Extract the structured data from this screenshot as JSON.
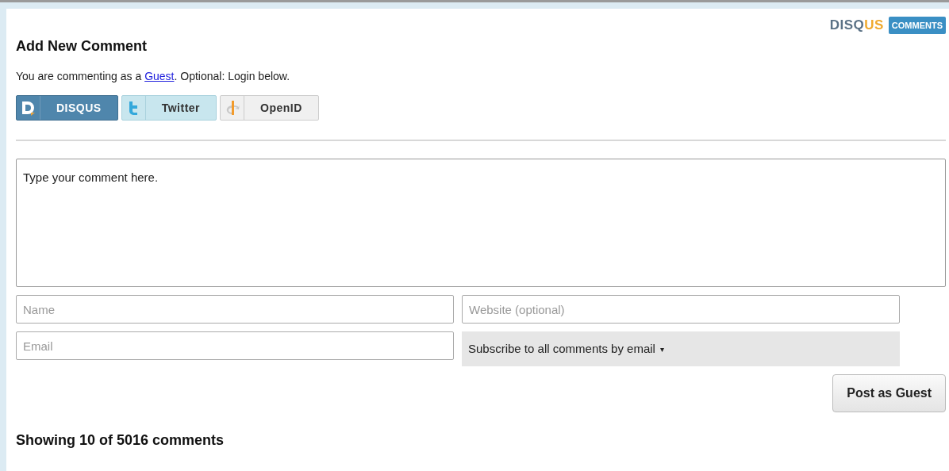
{
  "header": {
    "title": "Add New Comment",
    "logo": {
      "wordmark": "DISQUS",
      "badge": "COMMENTS"
    }
  },
  "intro": {
    "before": "You are commenting as a ",
    "link": "Guest",
    "after": ". Optional: Login below."
  },
  "login_buttons": [
    {
      "kind": "disqus",
      "label": "DISQUS",
      "selected": true
    },
    {
      "kind": "twitter",
      "label": "Twitter",
      "selected": false
    },
    {
      "kind": "openid",
      "label": "OpenID",
      "selected": false
    }
  ],
  "comment": {
    "value": "Type your comment here."
  },
  "fields": {
    "name": {
      "placeholder": "Name"
    },
    "website": {
      "placeholder": "Website (optional)"
    },
    "email": {
      "placeholder": "Email"
    }
  },
  "subscribe": {
    "label": "Subscribe to all comments by email",
    "caret": "▾"
  },
  "submit": {
    "label": "Post as Guest"
  },
  "count": "Showing 10 of 5016 comments"
}
